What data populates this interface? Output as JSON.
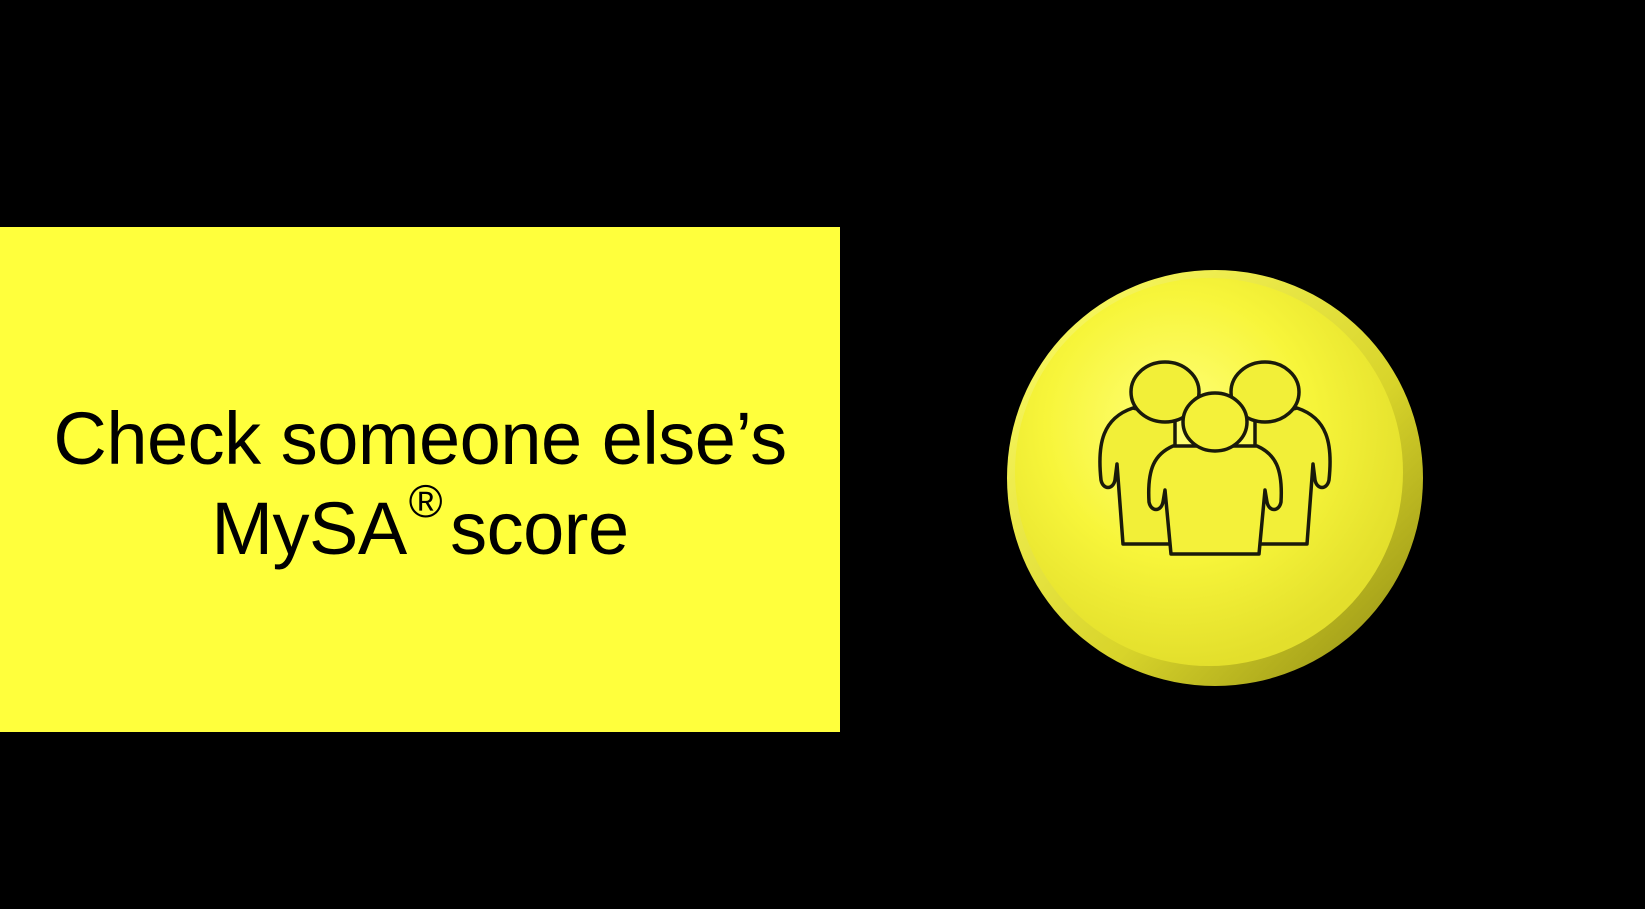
{
  "headline": {
    "line1": "Check someone else’s",
    "line2_prefix": "MySA",
    "line2_mark": "®",
    "line2_suffix": "score"
  },
  "badge": {
    "icon": "group-of-people-icon"
  },
  "colors": {
    "background": "#000000",
    "panel": "#FFFF3C",
    "badge_fill": "#F7F53A",
    "badge_rim": "#C9C528",
    "text": "#000000"
  }
}
